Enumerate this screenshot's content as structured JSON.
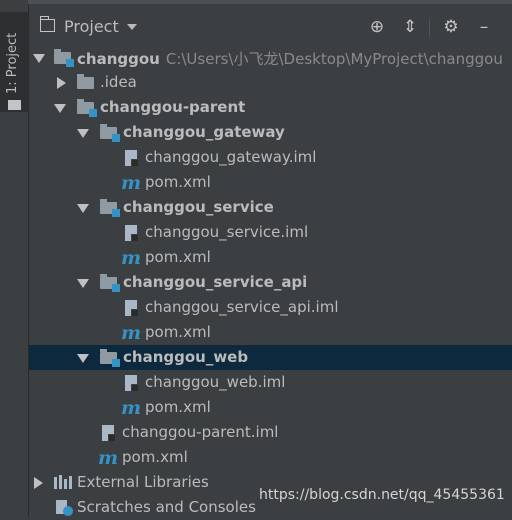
{
  "sidebar": {
    "tab_label": "1: Project"
  },
  "header": {
    "title": "Project"
  },
  "tree": {
    "root": {
      "name": "changgou",
      "path": "C:\\Users\\小飞龙\\Desktop\\MyProject\\changgou"
    },
    "idea": ".idea",
    "parent": "changgou-parent",
    "gateway": {
      "name": "changgou_gateway",
      "iml": "changgou_gateway.iml",
      "pom": "pom.xml"
    },
    "service": {
      "name": "changgou_service",
      "iml": "changgou_service.iml",
      "pom": "pom.xml"
    },
    "service_api": {
      "name": "changgou_service_api",
      "iml": "changgou_service_api.iml",
      "pom": "pom.xml"
    },
    "web": {
      "name": "changgou_web",
      "iml": "changgou_web.iml",
      "pom": "pom.xml"
    },
    "parent_iml": "changgou-parent.iml",
    "parent_pom": "pom.xml",
    "external_libraries": "External Libraries",
    "scratches": "Scratches and Consoles"
  },
  "watermark": "https://blog.csdn.net/qq_45455361",
  "colors": {
    "background": "#3c3f41",
    "selection": "#0d293e",
    "module_accent": "#3592c4",
    "text": "#bbbbbb"
  },
  "icons": {
    "collapse": "collapse-all-icon",
    "locate": "locate-icon",
    "settings": "gear-icon",
    "hide": "minimize-icon"
  }
}
